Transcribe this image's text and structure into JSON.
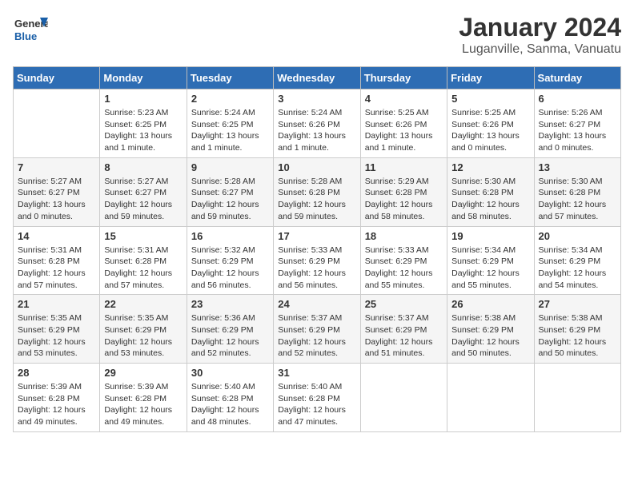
{
  "header": {
    "logo_line1": "General",
    "logo_line2": "Blue",
    "month": "January 2024",
    "location": "Luganville, Sanma, Vanuatu"
  },
  "days_of_week": [
    "Sunday",
    "Monday",
    "Tuesday",
    "Wednesday",
    "Thursday",
    "Friday",
    "Saturday"
  ],
  "weeks": [
    [
      {
        "day": "",
        "info": ""
      },
      {
        "day": "1",
        "info": "Sunrise: 5:23 AM\nSunset: 6:25 PM\nDaylight: 13 hours\nand 1 minute."
      },
      {
        "day": "2",
        "info": "Sunrise: 5:24 AM\nSunset: 6:25 PM\nDaylight: 13 hours\nand 1 minute."
      },
      {
        "day": "3",
        "info": "Sunrise: 5:24 AM\nSunset: 6:26 PM\nDaylight: 13 hours\nand 1 minute."
      },
      {
        "day": "4",
        "info": "Sunrise: 5:25 AM\nSunset: 6:26 PM\nDaylight: 13 hours\nand 1 minute."
      },
      {
        "day": "5",
        "info": "Sunrise: 5:25 AM\nSunset: 6:26 PM\nDaylight: 13 hours\nand 0 minutes."
      },
      {
        "day": "6",
        "info": "Sunrise: 5:26 AM\nSunset: 6:27 PM\nDaylight: 13 hours\nand 0 minutes."
      }
    ],
    [
      {
        "day": "7",
        "info": "Sunrise: 5:27 AM\nSunset: 6:27 PM\nDaylight: 13 hours\nand 0 minutes."
      },
      {
        "day": "8",
        "info": "Sunrise: 5:27 AM\nSunset: 6:27 PM\nDaylight: 12 hours\nand 59 minutes."
      },
      {
        "day": "9",
        "info": "Sunrise: 5:28 AM\nSunset: 6:27 PM\nDaylight: 12 hours\nand 59 minutes."
      },
      {
        "day": "10",
        "info": "Sunrise: 5:28 AM\nSunset: 6:28 PM\nDaylight: 12 hours\nand 59 minutes."
      },
      {
        "day": "11",
        "info": "Sunrise: 5:29 AM\nSunset: 6:28 PM\nDaylight: 12 hours\nand 58 minutes."
      },
      {
        "day": "12",
        "info": "Sunrise: 5:30 AM\nSunset: 6:28 PM\nDaylight: 12 hours\nand 58 minutes."
      },
      {
        "day": "13",
        "info": "Sunrise: 5:30 AM\nSunset: 6:28 PM\nDaylight: 12 hours\nand 57 minutes."
      }
    ],
    [
      {
        "day": "14",
        "info": "Sunrise: 5:31 AM\nSunset: 6:28 PM\nDaylight: 12 hours\nand 57 minutes."
      },
      {
        "day": "15",
        "info": "Sunrise: 5:31 AM\nSunset: 6:28 PM\nDaylight: 12 hours\nand 57 minutes."
      },
      {
        "day": "16",
        "info": "Sunrise: 5:32 AM\nSunset: 6:29 PM\nDaylight: 12 hours\nand 56 minutes."
      },
      {
        "day": "17",
        "info": "Sunrise: 5:33 AM\nSunset: 6:29 PM\nDaylight: 12 hours\nand 56 minutes."
      },
      {
        "day": "18",
        "info": "Sunrise: 5:33 AM\nSunset: 6:29 PM\nDaylight: 12 hours\nand 55 minutes."
      },
      {
        "day": "19",
        "info": "Sunrise: 5:34 AM\nSunset: 6:29 PM\nDaylight: 12 hours\nand 55 minutes."
      },
      {
        "day": "20",
        "info": "Sunrise: 5:34 AM\nSunset: 6:29 PM\nDaylight: 12 hours\nand 54 minutes."
      }
    ],
    [
      {
        "day": "21",
        "info": "Sunrise: 5:35 AM\nSunset: 6:29 PM\nDaylight: 12 hours\nand 53 minutes."
      },
      {
        "day": "22",
        "info": "Sunrise: 5:35 AM\nSunset: 6:29 PM\nDaylight: 12 hours\nand 53 minutes."
      },
      {
        "day": "23",
        "info": "Sunrise: 5:36 AM\nSunset: 6:29 PM\nDaylight: 12 hours\nand 52 minutes."
      },
      {
        "day": "24",
        "info": "Sunrise: 5:37 AM\nSunset: 6:29 PM\nDaylight: 12 hours\nand 52 minutes."
      },
      {
        "day": "25",
        "info": "Sunrise: 5:37 AM\nSunset: 6:29 PM\nDaylight: 12 hours\nand 51 minutes."
      },
      {
        "day": "26",
        "info": "Sunrise: 5:38 AM\nSunset: 6:29 PM\nDaylight: 12 hours\nand 50 minutes."
      },
      {
        "day": "27",
        "info": "Sunrise: 5:38 AM\nSunset: 6:29 PM\nDaylight: 12 hours\nand 50 minutes."
      }
    ],
    [
      {
        "day": "28",
        "info": "Sunrise: 5:39 AM\nSunset: 6:28 PM\nDaylight: 12 hours\nand 49 minutes."
      },
      {
        "day": "29",
        "info": "Sunrise: 5:39 AM\nSunset: 6:28 PM\nDaylight: 12 hours\nand 49 minutes."
      },
      {
        "day": "30",
        "info": "Sunrise: 5:40 AM\nSunset: 6:28 PM\nDaylight: 12 hours\nand 48 minutes."
      },
      {
        "day": "31",
        "info": "Sunrise: 5:40 AM\nSunset: 6:28 PM\nDaylight: 12 hours\nand 47 minutes."
      },
      {
        "day": "",
        "info": ""
      },
      {
        "day": "",
        "info": ""
      },
      {
        "day": "",
        "info": ""
      }
    ]
  ]
}
